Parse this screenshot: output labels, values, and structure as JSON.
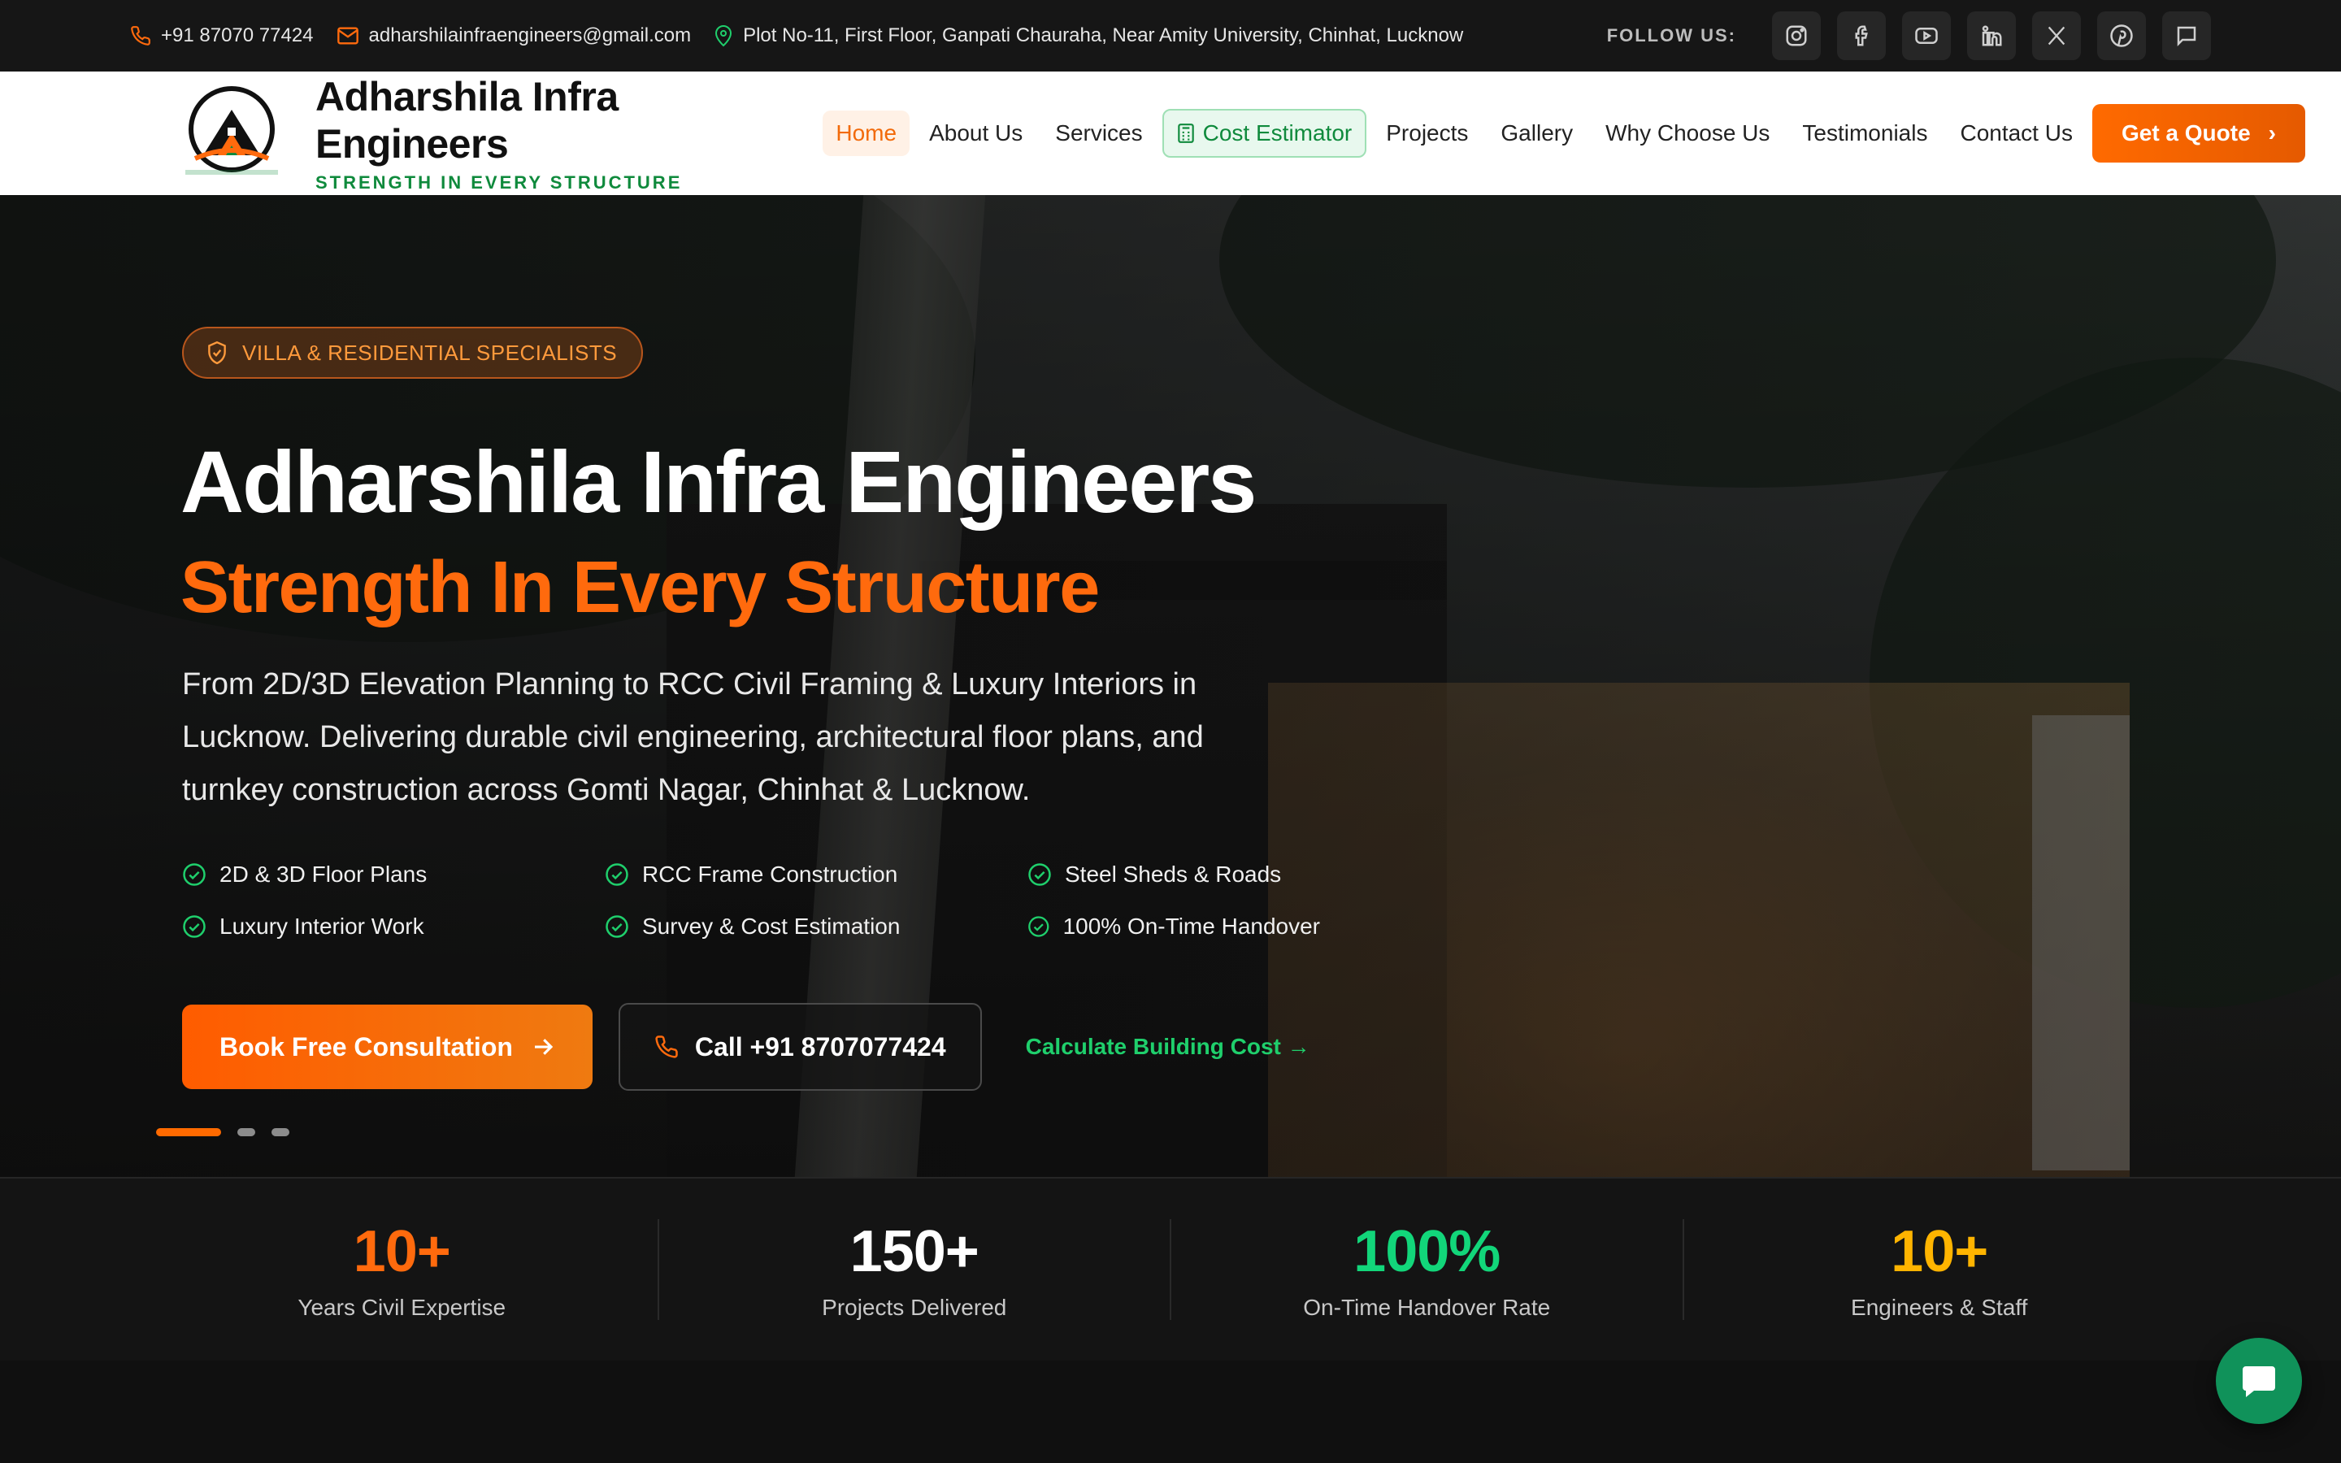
{
  "topbar": {
    "phone": "+91 87070 77424",
    "email": "adharshilainfraengineers@gmail.com",
    "address": "Plot No-11, First Floor, Ganpati Chauraha, Near Amity University, Chinhat, Lucknow",
    "follow_label": "FOLLOW US:",
    "socials": [
      "instagram-icon",
      "facebook-icon",
      "youtube-icon",
      "linkedin-icon",
      "x-icon",
      "pinterest-icon",
      "message-icon"
    ]
  },
  "brand": {
    "name": "Adharshila Infra Engineers",
    "tagline": "STRENGTH IN EVERY STRUCTURE",
    "logo_ring_text": "ADHARSHILA INFRA ENGINEERS",
    "logo_bottom_text": "STRENGTH IN EVERY STRUCTURE"
  },
  "nav": {
    "items": [
      "Home",
      "About Us",
      "Services",
      "Cost Estimator",
      "Projects",
      "Gallery",
      "Why Choose Us",
      "Testimonials",
      "Contact Us"
    ],
    "active": "Home",
    "cta": "Get a Quote"
  },
  "hero": {
    "badge": "VILLA & RESIDENTIAL SPECIALISTS",
    "title": "Adharshila Infra Engineers",
    "subtitle": "Strength In Every Structure",
    "description": "From 2D/3D Elevation Planning to RCC Civil Framing & Luxury Interiors in Lucknow. Delivering durable civil engineering, architectural floor plans, and turnkey construction across Gomti Nagar, Chinhat & Lucknow.",
    "features": [
      "2D & 3D Floor Plans",
      "RCC Frame Construction",
      "Steel Sheds & Roads",
      "Luxury Interior Work",
      "Survey & Cost Estimation",
      "100% On-Time Handover"
    ],
    "primary_cta": "Book Free Consultation",
    "call_cta": "Call +91 8707077424",
    "link_cta": "Calculate Building Cost →",
    "slides": 3,
    "active_slide": 1
  },
  "stats": [
    {
      "value": "10+",
      "label": "Years Civil Expertise",
      "color": "#ff6a0d"
    },
    {
      "value": "150+",
      "label": "Projects Delivered",
      "color": "#ffffff"
    },
    {
      "value": "100%",
      "label": "On-Time Handover Rate",
      "color": "#12d67a"
    },
    {
      "value": "10+",
      "label": "Engineers & Staff",
      "color": "#ffb400"
    }
  ],
  "colors": {
    "accent": "#ff6a0d",
    "brand_green": "#0f8a3c",
    "link_green": "#1fcf6c"
  }
}
